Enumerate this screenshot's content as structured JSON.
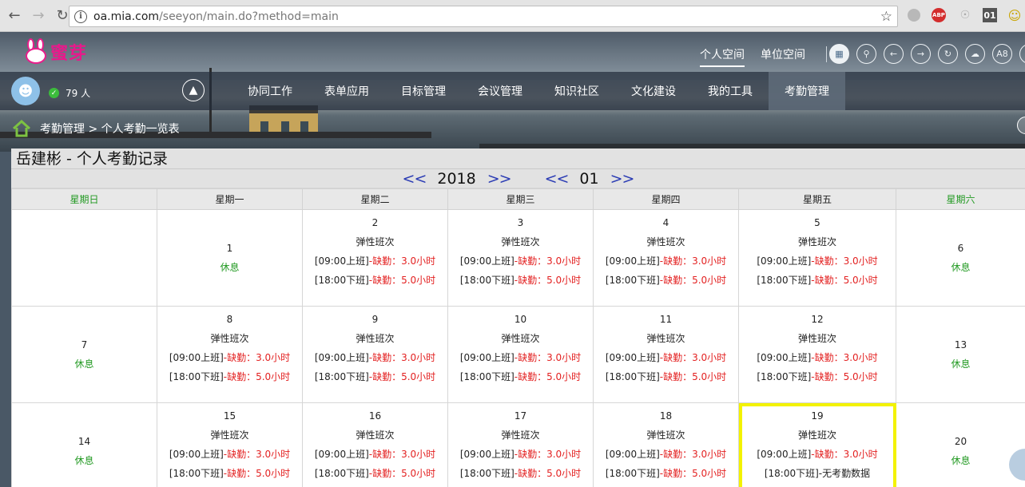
{
  "browser": {
    "url_host": "oa.mia.com",
    "url_path": "/seeyon/main.do?method=main",
    "ext_abp": "ABP",
    "ext_01": "01"
  },
  "app": {
    "logo_text": "蜜芽",
    "top_tabs": [
      "个人空间",
      "单位空间"
    ],
    "toolbar_icon_a8": "A8",
    "online_count": "79 人",
    "menu": [
      "协同工作",
      "表单应用",
      "目标管理",
      "会议管理",
      "知识社区",
      "文化建设",
      "我的工具",
      "考勤管理"
    ],
    "breadcrumb": "考勤管理 > 个人考勤一览表"
  },
  "calendar": {
    "title": "岳建彬 - 个人考勤记录",
    "nav_prev": "<<",
    "nav_next": ">>",
    "year": "2018",
    "month": "01",
    "weekdays": [
      "星期日",
      "星期一",
      "星期二",
      "星期三",
      "星期四",
      "星期五",
      "星期六"
    ],
    "shift": "弹性班次",
    "rest": "休息",
    "in_label": "[09:00上班]",
    "out_label": "[18:00下班]",
    "absent_in": "-缺勤：3.0小时",
    "absent_out": "-缺勤：5.0小时",
    "no_data": "-无考勤数据",
    "weeks": [
      [
        "",
        "1",
        "2",
        "3",
        "4",
        "5",
        "6"
      ],
      [
        "7",
        "8",
        "9",
        "10",
        "11",
        "12",
        "13"
      ],
      [
        "14",
        "15",
        "16",
        "17",
        "18",
        "19",
        "20"
      ]
    ]
  }
}
